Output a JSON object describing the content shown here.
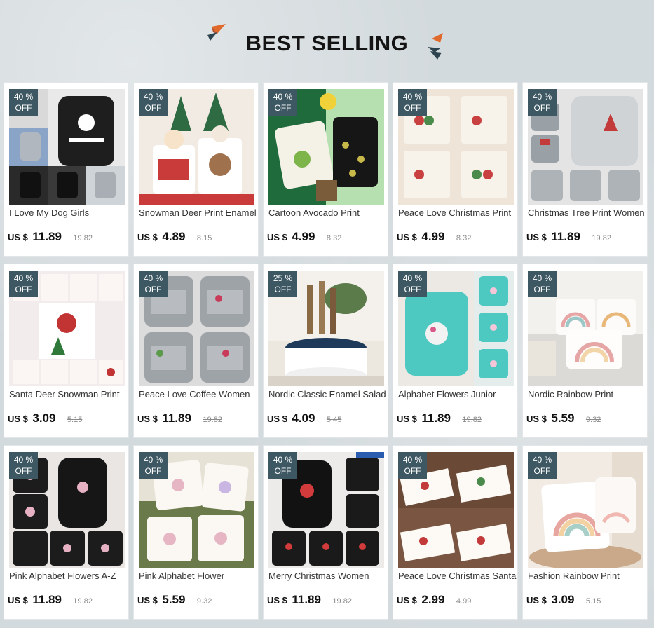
{
  "header": {
    "title": "BEST SELLING"
  },
  "colors": {
    "badge": "#3e5863",
    "accent_orange": "#e06a2c",
    "accent_dark": "#2d4450",
    "background": "#d3dadd"
  },
  "products": [
    {
      "name": "I Love My Dog Girls",
      "discount_pct": "40 %",
      "discount_word": "OFF",
      "currency": "US $",
      "price": "11.89",
      "original_price": "19.82"
    },
    {
      "name": "Snowman Deer Print Enamel",
      "discount_pct": "40 %",
      "discount_word": "OFF",
      "currency": "US $",
      "price": "4.89",
      "original_price": "8.15"
    },
    {
      "name": "Cartoon Avocado Print",
      "discount_pct": "40 %",
      "discount_word": "OFF",
      "currency": "US $",
      "price": "4.99",
      "original_price": "8.32"
    },
    {
      "name": "Peace Love Christmas Print",
      "discount_pct": "40 %",
      "discount_word": "OFF",
      "currency": "US $",
      "price": "4.99",
      "original_price": "8.32"
    },
    {
      "name": "Christmas Tree Print Women",
      "discount_pct": "40 %",
      "discount_word": "OFF",
      "currency": "US $",
      "price": "11.89",
      "original_price": "19.82"
    },
    {
      "name": "Santa Deer Snowman Print",
      "discount_pct": "40 %",
      "discount_word": "OFF",
      "currency": "US $",
      "price": "3.09",
      "original_price": "5.15"
    },
    {
      "name": "Peace Love Coffee Women",
      "discount_pct": "40 %",
      "discount_word": "OFF",
      "currency": "US $",
      "price": "11.89",
      "original_price": "19.82"
    },
    {
      "name": "Nordic Classic Enamel Salad",
      "discount_pct": "25 %",
      "discount_word": "OFF",
      "currency": "US $",
      "price": "4.09",
      "original_price": "5.45"
    },
    {
      "name": "Alphabet Flowers Junior",
      "discount_pct": "40 %",
      "discount_word": "OFF",
      "currency": "US $",
      "price": "11.89",
      "original_price": "19.82"
    },
    {
      "name": "Nordic Rainbow Print",
      "discount_pct": "40 %",
      "discount_word": "OFF",
      "currency": "US $",
      "price": "5.59",
      "original_price": "9.32"
    },
    {
      "name": "Pink Alphabet Flowers A-Z",
      "discount_pct": "40 %",
      "discount_word": "OFF",
      "currency": "US $",
      "price": "11.89",
      "original_price": "19.82"
    },
    {
      "name": "Pink Alphabet Flower",
      "discount_pct": "40 %",
      "discount_word": "OFF",
      "currency": "US $",
      "price": "5.59",
      "original_price": "9.32"
    },
    {
      "name": "Merry Christmas Women",
      "discount_pct": "40 %",
      "discount_word": "OFF",
      "currency": "US $",
      "price": "11.89",
      "original_price": "19.82"
    },
    {
      "name": "Peace Love Christmas Santa",
      "discount_pct": "40 %",
      "discount_word": "OFF",
      "currency": "US $",
      "price": "2.99",
      "original_price": "4.99"
    },
    {
      "name": "Fashion Rainbow Print",
      "discount_pct": "40 %",
      "discount_word": "OFF",
      "currency": "US $",
      "price": "3.09",
      "original_price": "5.15"
    }
  ]
}
